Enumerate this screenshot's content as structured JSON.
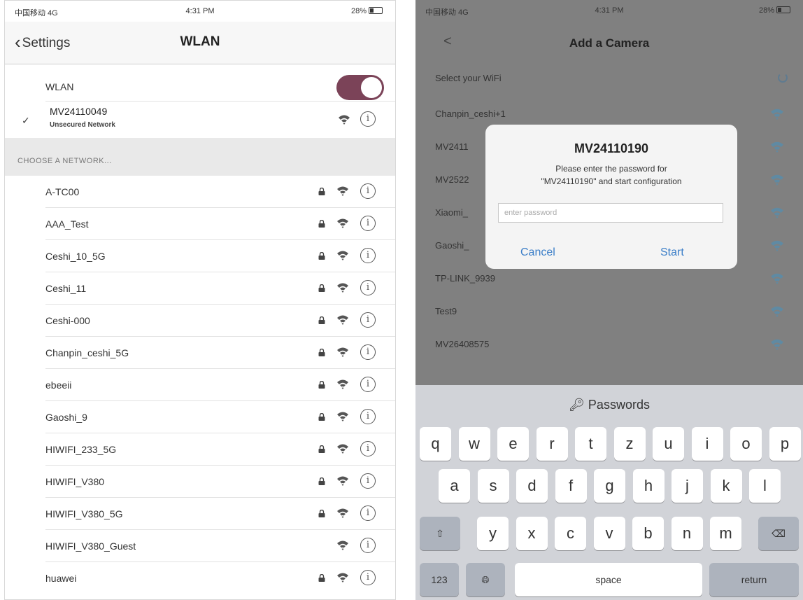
{
  "left": {
    "status": {
      "carrier": "中国移动 4G",
      "time": "4:31 PM",
      "battery": "28%"
    },
    "back_label": "Settings",
    "title": "WLAN",
    "wlan_label": "WLAN",
    "wlan_on": true,
    "connected": {
      "name": "MV24110049",
      "subtitle": "Unsecured Network"
    },
    "section_header": "CHOOSE A NETWORK...",
    "networks": [
      {
        "name": "A-TC00",
        "locked": true
      },
      {
        "name": "AAA_Test",
        "locked": true
      },
      {
        "name": "Ceshi_10_5G",
        "locked": true
      },
      {
        "name": "Ceshi_11",
        "locked": true
      },
      {
        "name": "Ceshi-000",
        "locked": true
      },
      {
        "name": "Chanpin_ceshi_5G",
        "locked": true
      },
      {
        "name": "ebeeii",
        "locked": true
      },
      {
        "name": "Gaoshi_9",
        "locked": true
      },
      {
        "name": "HIWIFI_233_5G",
        "locked": true
      },
      {
        "name": "HIWIFI_V380",
        "locked": true
      },
      {
        "name": "HIWIFI_V380_5G",
        "locked": true
      },
      {
        "name": "HIWIFI_V380_Guest",
        "locked": false
      },
      {
        "name": "huawei",
        "locked": true
      }
    ],
    "icons": {
      "check": "checkmark-icon",
      "wifi": "wifi-icon",
      "lock": "lock-icon",
      "info": "info-icon"
    }
  },
  "right": {
    "status": {
      "carrier": "中国移动 4G",
      "time": "4:31 PM",
      "battery": "28%"
    },
    "back_label": "<",
    "title": "Add a Camera",
    "select_label": "Select your WiFi",
    "wifi_list": [
      "Chanpin_ceshi+1",
      "MV2411",
      "MV2522",
      "Xiaomi_",
      "Gaoshi_",
      "TP-LINK_9939",
      "Test9",
      "MV26408575"
    ],
    "dialog": {
      "title": "MV24110190",
      "message_line1": "Please enter the password for",
      "message_line2": "\"MV24110190\" and start configuration",
      "input_placeholder": "enter password",
      "cancel": "Cancel",
      "start": "Start"
    },
    "keyboard": {
      "passwords_label": "Passwords",
      "row1": [
        "q",
        "w",
        "e",
        "r",
        "t",
        "z",
        "u",
        "i",
        "o",
        "p"
      ],
      "row2": [
        "a",
        "s",
        "d",
        "f",
        "g",
        "h",
        "j",
        "k",
        "l"
      ],
      "row3": [
        "y",
        "x",
        "c",
        "v",
        "b",
        "n",
        "m"
      ],
      "numbers": "123",
      "space": "space",
      "return": "return"
    }
  },
  "colors": {
    "toggle": "#7b4358",
    "link": "#3b7ec8",
    "overlay": "#808080",
    "keyboard": "#d1d3d8"
  }
}
